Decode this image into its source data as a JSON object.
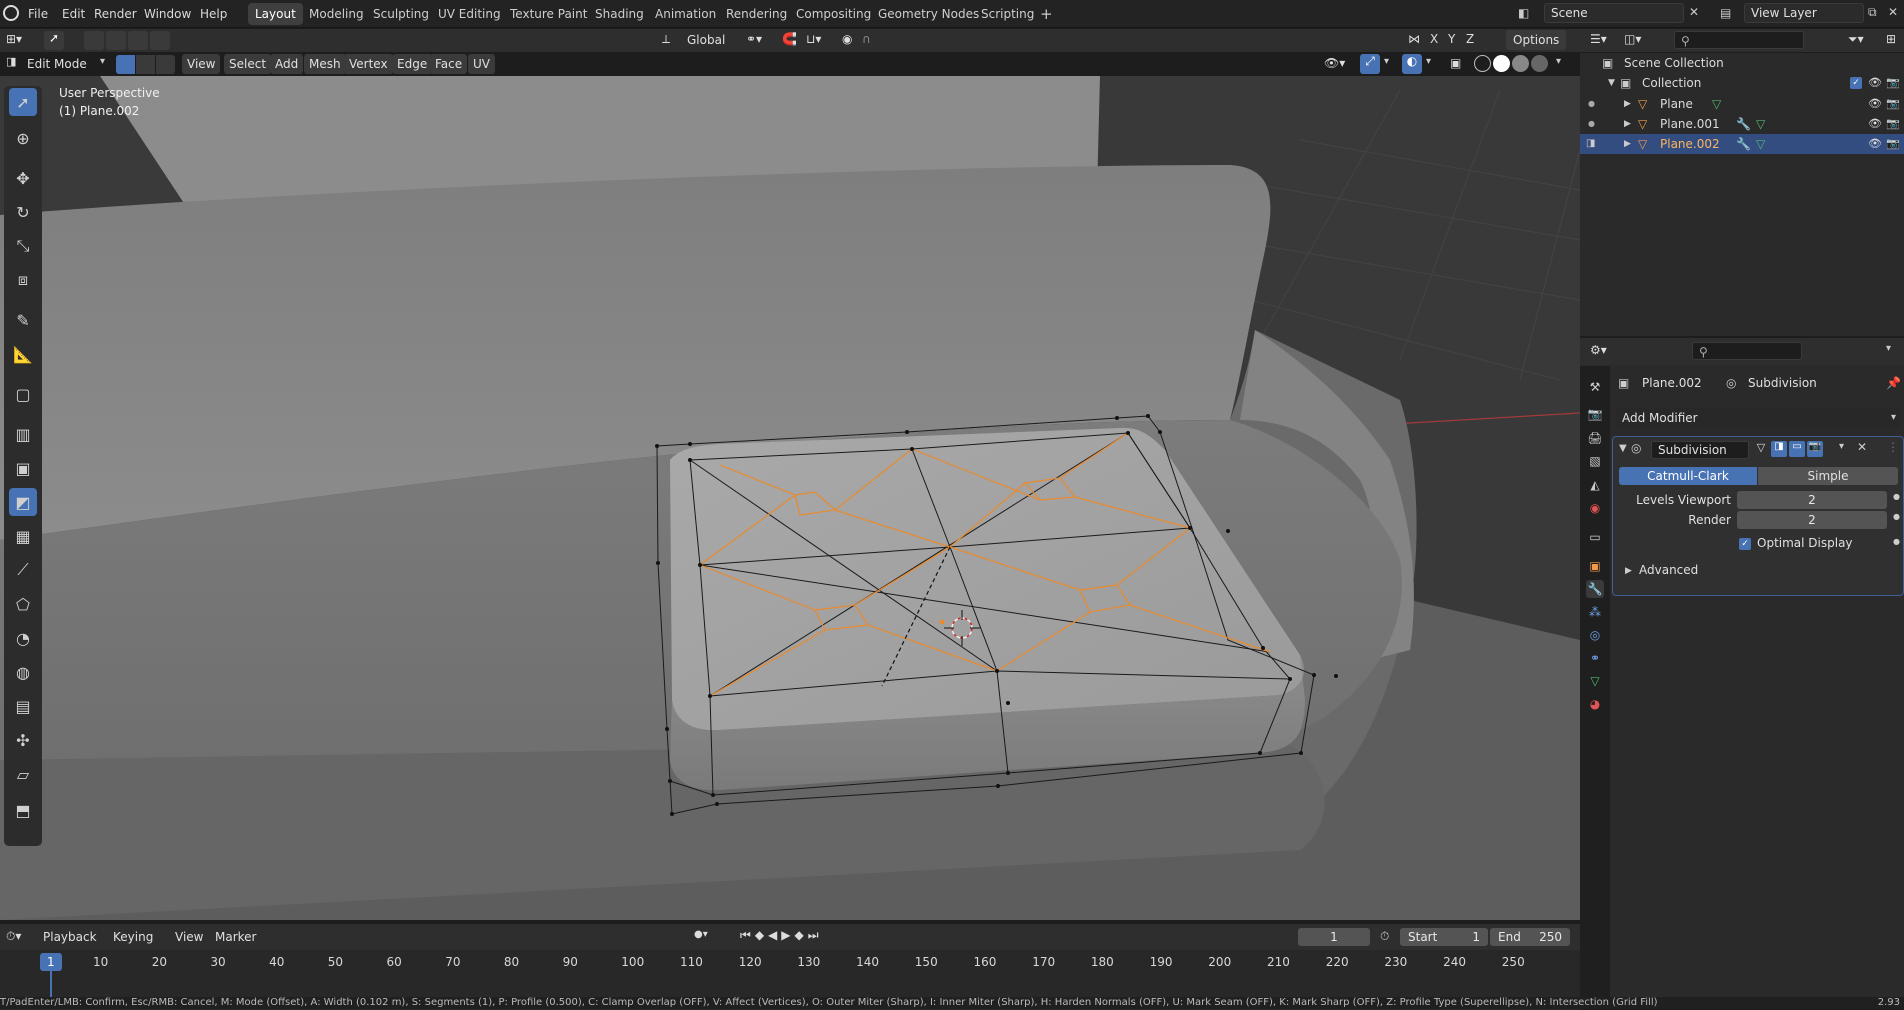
{
  "menu": {
    "file": "File",
    "edit": "Edit",
    "render": "Render",
    "window": "Window",
    "help": "Help"
  },
  "workspaces": [
    "Layout",
    "Modeling",
    "Sculpting",
    "UV Editing",
    "Texture Paint",
    "Shading",
    "Animation",
    "Rendering",
    "Compositing",
    "Geometry Nodes",
    "Scripting"
  ],
  "scene": {
    "name": "Scene",
    "view_layer": "View Layer"
  },
  "header": {
    "transform": "Global",
    "options": "Options",
    "axes": [
      "X",
      "Y",
      "Z"
    ]
  },
  "edit_header": {
    "mode": "Edit Mode",
    "menus": [
      "View",
      "Select",
      "Add",
      "Mesh",
      "Vertex",
      "Edge",
      "Face",
      "UV"
    ]
  },
  "viewport": {
    "perspective": "User Perspective",
    "object_label": "(1) Plane.002"
  },
  "outliner": {
    "root": "Scene Collection",
    "collection": "Collection",
    "objects": [
      {
        "name": "Plane",
        "selected": false
      },
      {
        "name": "Plane.001",
        "selected": false
      },
      {
        "name": "Plane.002",
        "selected": true
      }
    ]
  },
  "properties": {
    "object": "Plane.002",
    "modifier_context": "Subdivision",
    "add_modifier": "Add Modifier",
    "modifier_name": "Subdivision",
    "type_catmull": "Catmull-Clark",
    "type_simple": "Simple",
    "levels_viewport_label": "Levels Viewport",
    "levels_viewport": "2",
    "render_label": "Render",
    "render_value": "2",
    "optimal_display": "Optimal Display",
    "advanced": "Advanced"
  },
  "timeline": {
    "menus": [
      "Playback",
      "Keying",
      "View",
      "Marker"
    ],
    "current_frame": "1",
    "start_label": "Start",
    "start": "1",
    "end_label": "End",
    "end": "250",
    "ticks": [
      "1",
      "10",
      "20",
      "30",
      "40",
      "50",
      "60",
      "70",
      "80",
      "90",
      "100",
      "110",
      "120",
      "130",
      "140",
      "150",
      "160",
      "170",
      "180",
      "190",
      "200",
      "210",
      "220",
      "230",
      "240",
      "250"
    ]
  },
  "status": "T/PadEnter/LMB: Confirm, Esc/RMB: Cancel, M: Mode (Offset), A: Width (0.102 m), S: Segments (1), P: Profile (0.500), C: Clamp Overlap (OFF), V: Affect (Vertices), O: Outer Miter (Sharp), I: Inner Miter (Sharp), H: Harden Normals (OFF), U: Mark Seam (OFF), K: Mark Sharp (OFF), Z: Profile Type (Superellipse), N: Intersection (Grid Fill)",
  "version": "2.93",
  "colors": {
    "accent": "#4772b3",
    "selected_edge": "#e98a2e",
    "grid_x": "#a33a3a"
  }
}
